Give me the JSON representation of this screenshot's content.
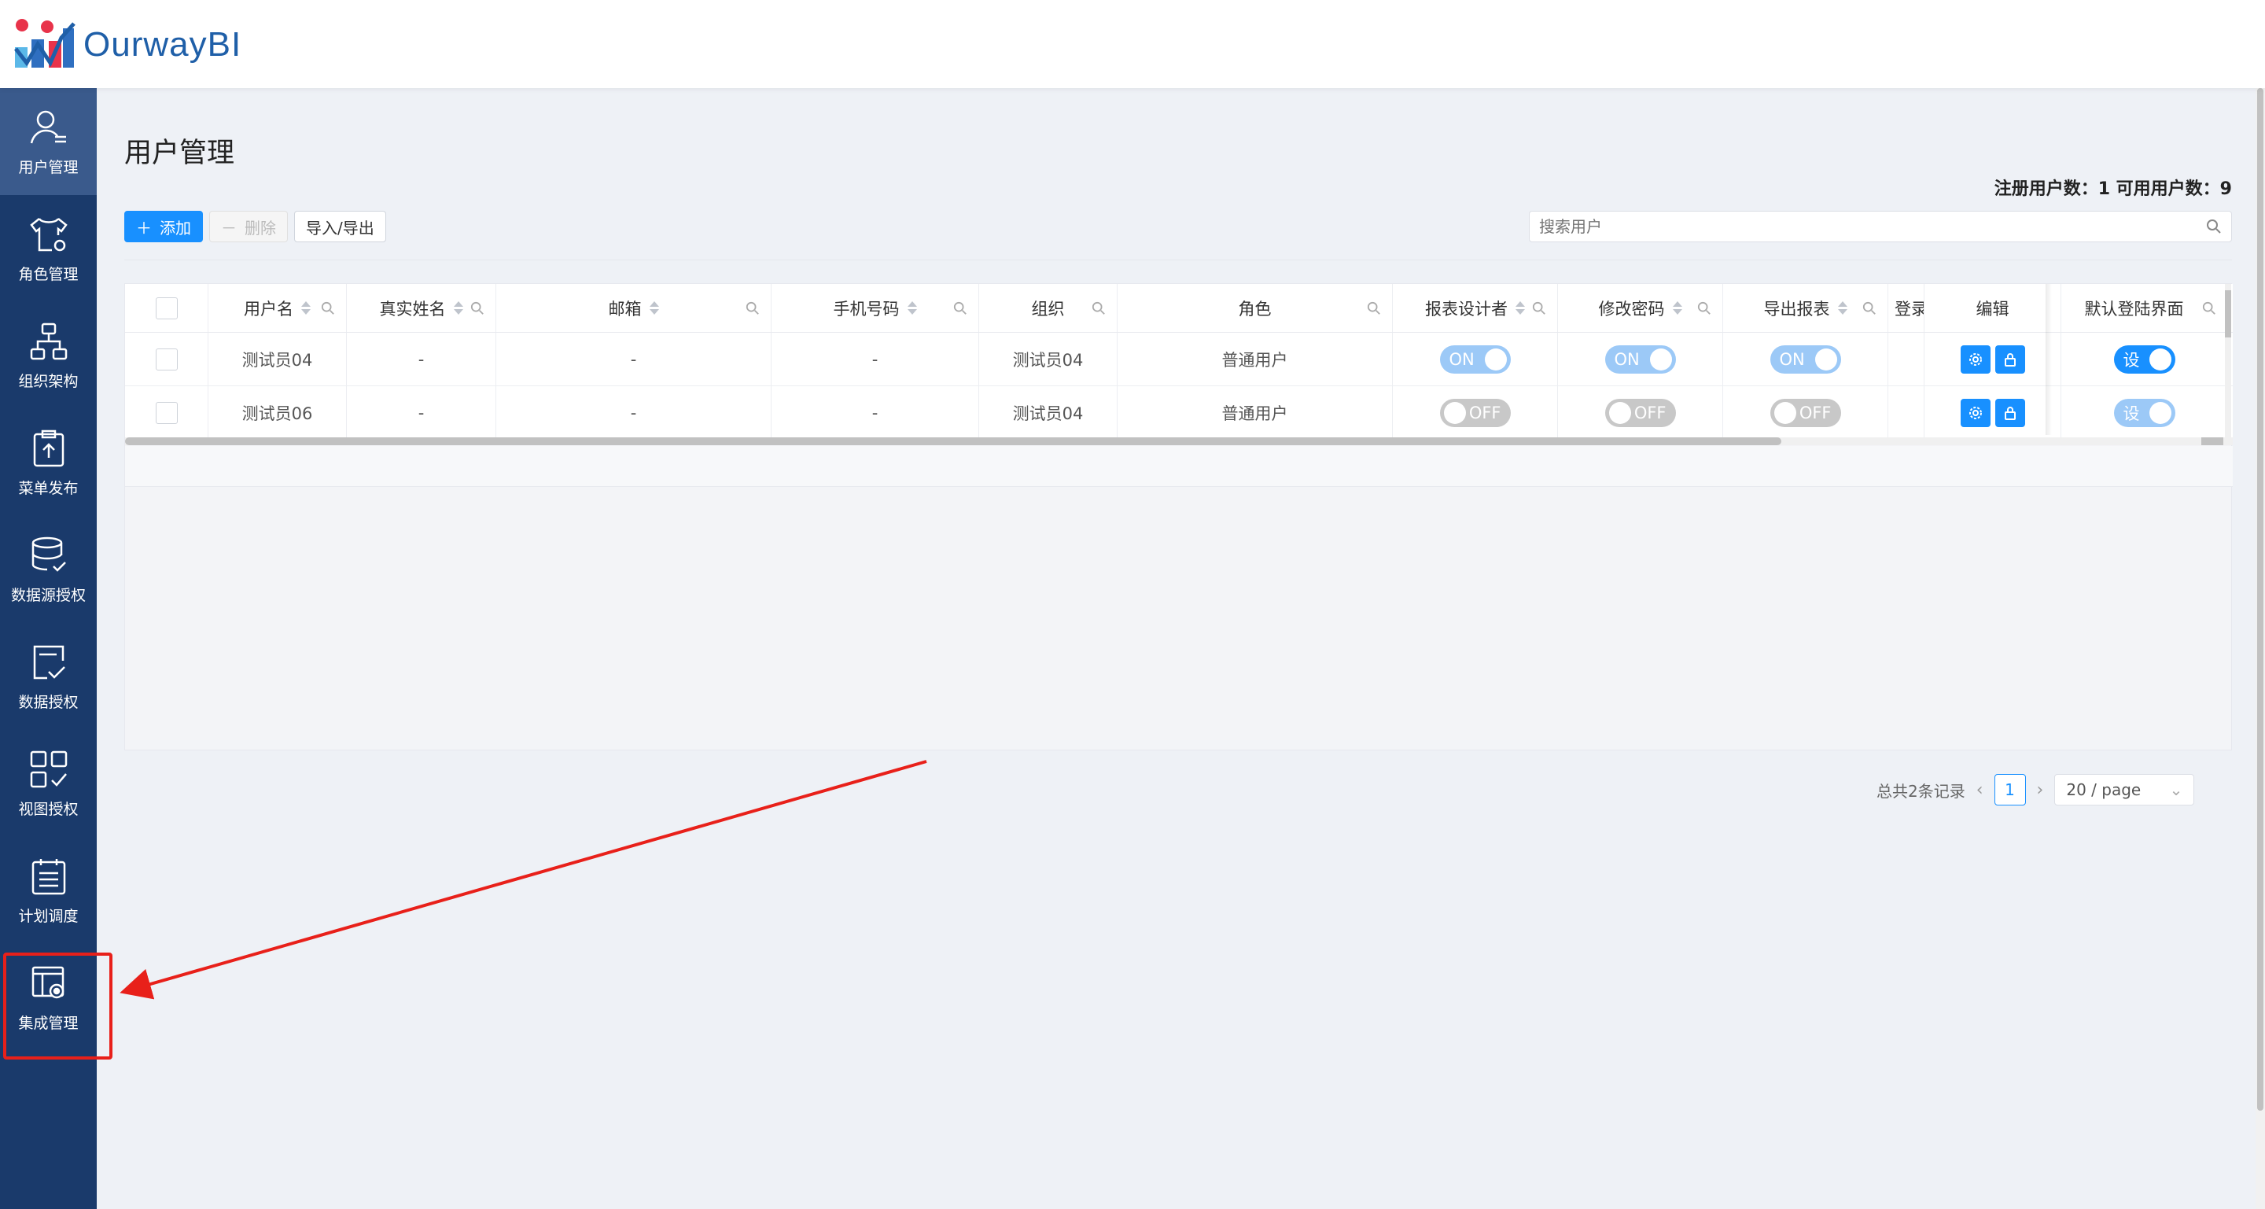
{
  "app": {
    "logo_text": "OurwayBI",
    "brand_color": "#1f5fa8",
    "sidebar_bg": "#1a3a6b",
    "accent": "#1890ff"
  },
  "sidebar": {
    "items": [
      {
        "label": "用户管理",
        "icon": "user-icon",
        "active": true
      },
      {
        "label": "角色管理",
        "icon": "shirt-gear-icon",
        "active": false
      },
      {
        "label": "组织架构",
        "icon": "org-chart-icon",
        "active": false
      },
      {
        "label": "菜单发布",
        "icon": "clipboard-upload-icon",
        "active": false
      },
      {
        "label": "数据源授权",
        "icon": "database-check-icon",
        "active": false
      },
      {
        "label": "数据授权",
        "icon": "chart-check-icon",
        "active": false
      },
      {
        "label": "视图授权",
        "icon": "grid-check-icon",
        "active": false
      },
      {
        "label": "计划调度",
        "icon": "calendar-list-icon",
        "active": false
      },
      {
        "label": "集成管理",
        "icon": "window-gear-icon",
        "active": false
      }
    ]
  },
  "main": {
    "title": "用户管理",
    "stats": "注册用户数：1   可用用户数：9",
    "toolbar": {
      "add_label": "添加",
      "delete_label": "删除",
      "import_export_label": "导入/导出"
    },
    "search": {
      "placeholder": "搜索用户"
    }
  },
  "table": {
    "columns": [
      "用户名",
      "真实姓名",
      "邮箱",
      "手机号码",
      "组织",
      "角色",
      "报表设计者",
      "修改密码",
      "导出报表",
      "登录",
      "编辑",
      "默认登陆界面"
    ],
    "rows": [
      {
        "username": "测试员04",
        "real_name": "-",
        "email": "-",
        "phone": "-",
        "org": "测试员04",
        "role": "普通用户",
        "designer": "ON",
        "change_pwd": "ON",
        "export": "ON",
        "default_label": "设"
      },
      {
        "username": "测试员06",
        "real_name": "-",
        "email": "-",
        "phone": "-",
        "org": "测试员04",
        "role": "普通用户",
        "designer": "OFF",
        "change_pwd": "OFF",
        "export": "OFF",
        "default_label": "设"
      }
    ]
  },
  "pagination": {
    "total": "总共2条记录",
    "current_page": "1",
    "page_size": "20 / page"
  }
}
